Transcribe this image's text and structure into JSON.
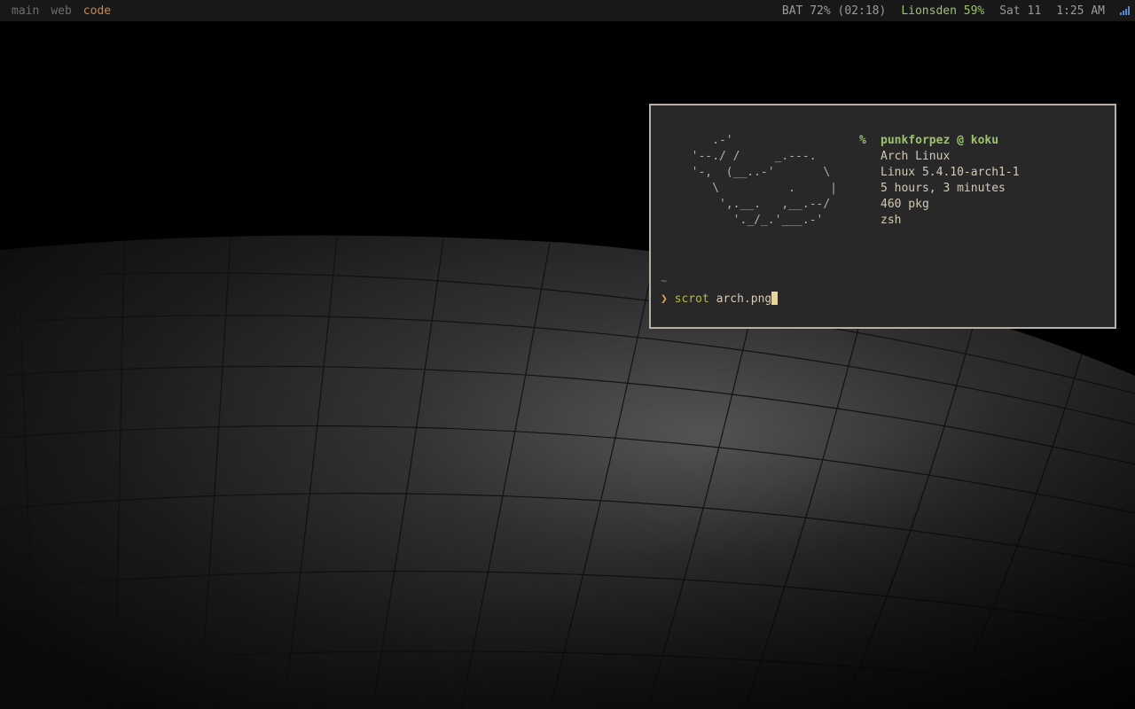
{
  "bar": {
    "workspaces": [
      "main",
      "web",
      "code"
    ],
    "active_workspace": "code",
    "battery": "BAT 72% (02:18)",
    "wifi": "Lionsden 59%",
    "date": "Sat 11",
    "time": "1:25 AM",
    "signal_icon": "signal-bars-icon"
  },
  "colors": {
    "accent_orange": "#d9813f",
    "green": "#9dc26e",
    "terminal_bg": "#282828",
    "terminal_border": "#b8b0a4"
  },
  "terminal": {
    "ascii_art": "     .-'                \n  '--./ /     _.---.    \n  '-,  (__..-'       \\  \n     \\          .     | \n      ',.__.   ,__.--/  \n        '._/_.'___.-'   ",
    "percent": "%",
    "user_host": "punkforpez @ koku",
    "info": [
      "Arch Linux",
      "Linux 5.4.10-arch1-1",
      "5 hours, 3 minutes",
      "460 pkg",
      "zsh"
    ],
    "cwd": "~",
    "prompt_symbol": "❯",
    "command": "scrot",
    "argument": "arch.png"
  }
}
